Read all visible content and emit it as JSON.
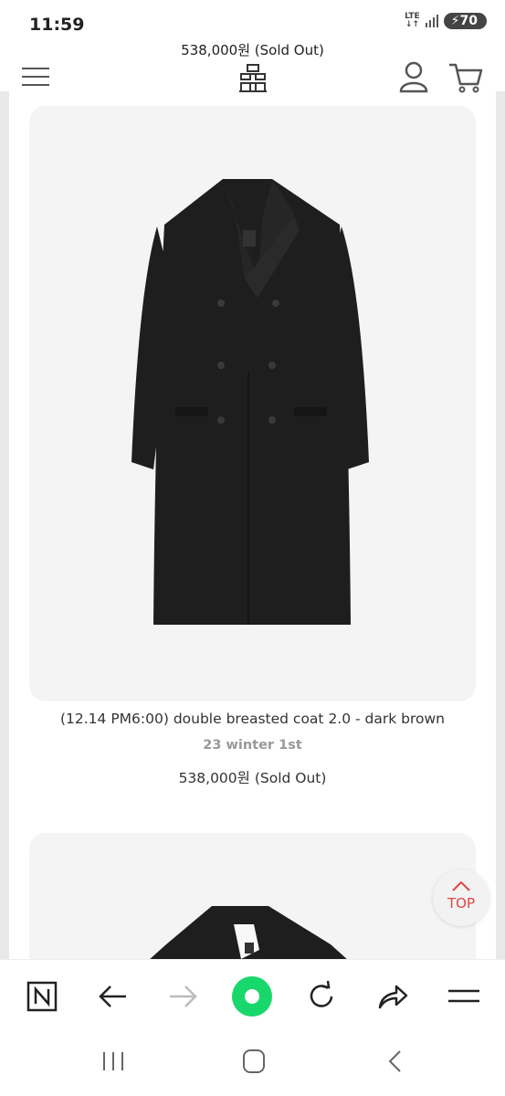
{
  "status_bar": {
    "time": "11:59",
    "network": "LTE",
    "battery": "70"
  },
  "page": {
    "top_price": "538,000원 (Sold Out)"
  },
  "product": {
    "title": "(12.14 PM6:00) double breasted coat 2.0 - dark brown",
    "subtitle": "23 winter 1st",
    "price": "538,000원 (Sold Out)"
  },
  "top_button": {
    "label": "TOP"
  },
  "colors": {
    "accent_top": "#e0463e",
    "home_button": "#19d86b",
    "coat": "#1e1e1e"
  },
  "icons": {
    "header": [
      "menu-icon",
      "brand-logo",
      "user-icon",
      "cart-icon"
    ],
    "browser": [
      "naver-n-icon",
      "back-arrow-icon",
      "forward-arrow-icon",
      "home-green-icon",
      "refresh-icon",
      "share-icon",
      "menu-icon"
    ],
    "system": [
      "recent-apps-icon",
      "home-icon",
      "back-icon"
    ]
  }
}
